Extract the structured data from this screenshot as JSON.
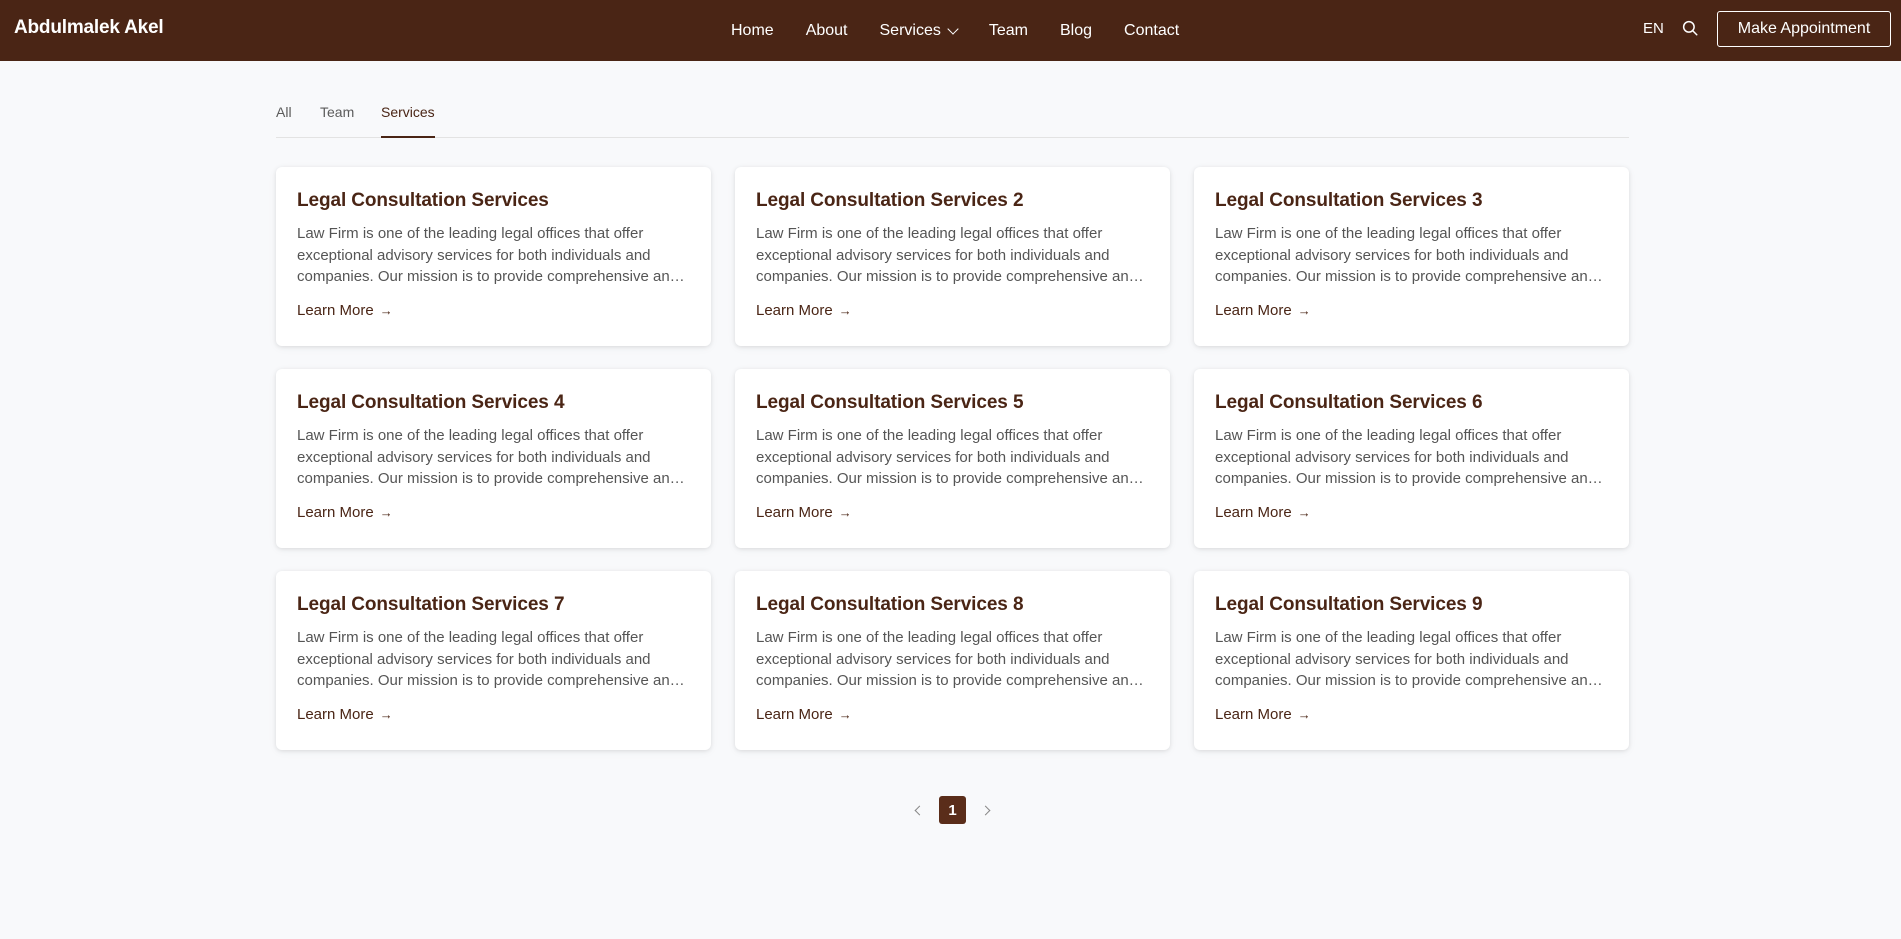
{
  "header": {
    "brand": "Abdulmalek Akel",
    "nav": [
      {
        "label": "Home"
      },
      {
        "label": "About"
      },
      {
        "label": "Services",
        "has_dropdown": true
      },
      {
        "label": "Team"
      },
      {
        "label": "Blog"
      },
      {
        "label": "Contact"
      }
    ],
    "language": "EN",
    "cta_label": "Make Appointment"
  },
  "tabs": [
    {
      "label": "All"
    },
    {
      "label": "Team"
    },
    {
      "label": "Services",
      "active": true
    }
  ],
  "cards": [
    {
      "title": "Legal Consultation Services",
      "description": "Law Firm is one of the leading legal offices that offer exceptional advisory services for both individuals and companies. Our mission is to provide comprehensive and ...",
      "link_label": "Learn More"
    },
    {
      "title": "Legal Consultation Services 2",
      "description": "Law Firm is one of the leading legal offices that offer exceptional advisory services for both individuals and companies. Our mission is to provide comprehensive and ...",
      "link_label": "Learn More"
    },
    {
      "title": "Legal Consultation Services 3",
      "description": "Law Firm is one of the leading legal offices that offer exceptional advisory services for both individuals and companies. Our mission is to provide comprehensive and ...",
      "link_label": "Learn More"
    },
    {
      "title": "Legal Consultation Services 4",
      "description": "Law Firm is one of the leading legal offices that offer exceptional advisory services for both individuals and companies. Our mission is to provide comprehensive and ...",
      "link_label": "Learn More"
    },
    {
      "title": "Legal Consultation Services 5",
      "description": "Law Firm is one of the leading legal offices that offer exceptional advisory services for both individuals and companies. Our mission is to provide comprehensive and ...",
      "link_label": "Learn More"
    },
    {
      "title": "Legal Consultation Services 6",
      "description": "Law Firm is one of the leading legal offices that offer exceptional advisory services for both individuals and companies. Our mission is to provide comprehensive and ...",
      "link_label": "Learn More"
    },
    {
      "title": "Legal Consultation Services 7",
      "description": "Law Firm is one of the leading legal offices that offer exceptional advisory services for both individuals and companies. Our mission is to provide comprehensive and ...",
      "link_label": "Learn More"
    },
    {
      "title": "Legal Consultation Services 8",
      "description": "Law Firm is one of the leading legal offices that offer exceptional advisory services for both individuals and companies. Our mission is to provide comprehensive and ...",
      "link_label": "Learn More"
    },
    {
      "title": "Legal Consultation Services 9",
      "description": "Law Firm is one of the leading legal offices that offer exceptional advisory services for both individuals and companies. Our mission is to provide comprehensive and ...",
      "link_label": "Learn More"
    }
  ],
  "pagination": {
    "current_page": "1"
  },
  "icons": {
    "search": "search-icon",
    "dropdown": "chevron-down-icon",
    "link_arrow": "arrow-right-icon",
    "prev": "chevron-left-icon",
    "next": "chevron-right-icon"
  },
  "colors": {
    "header_bg": "#4a2515",
    "accent": "#4a2515",
    "page_bg": "#f8f9fb",
    "active_page_bg": "#5a2d1a"
  }
}
